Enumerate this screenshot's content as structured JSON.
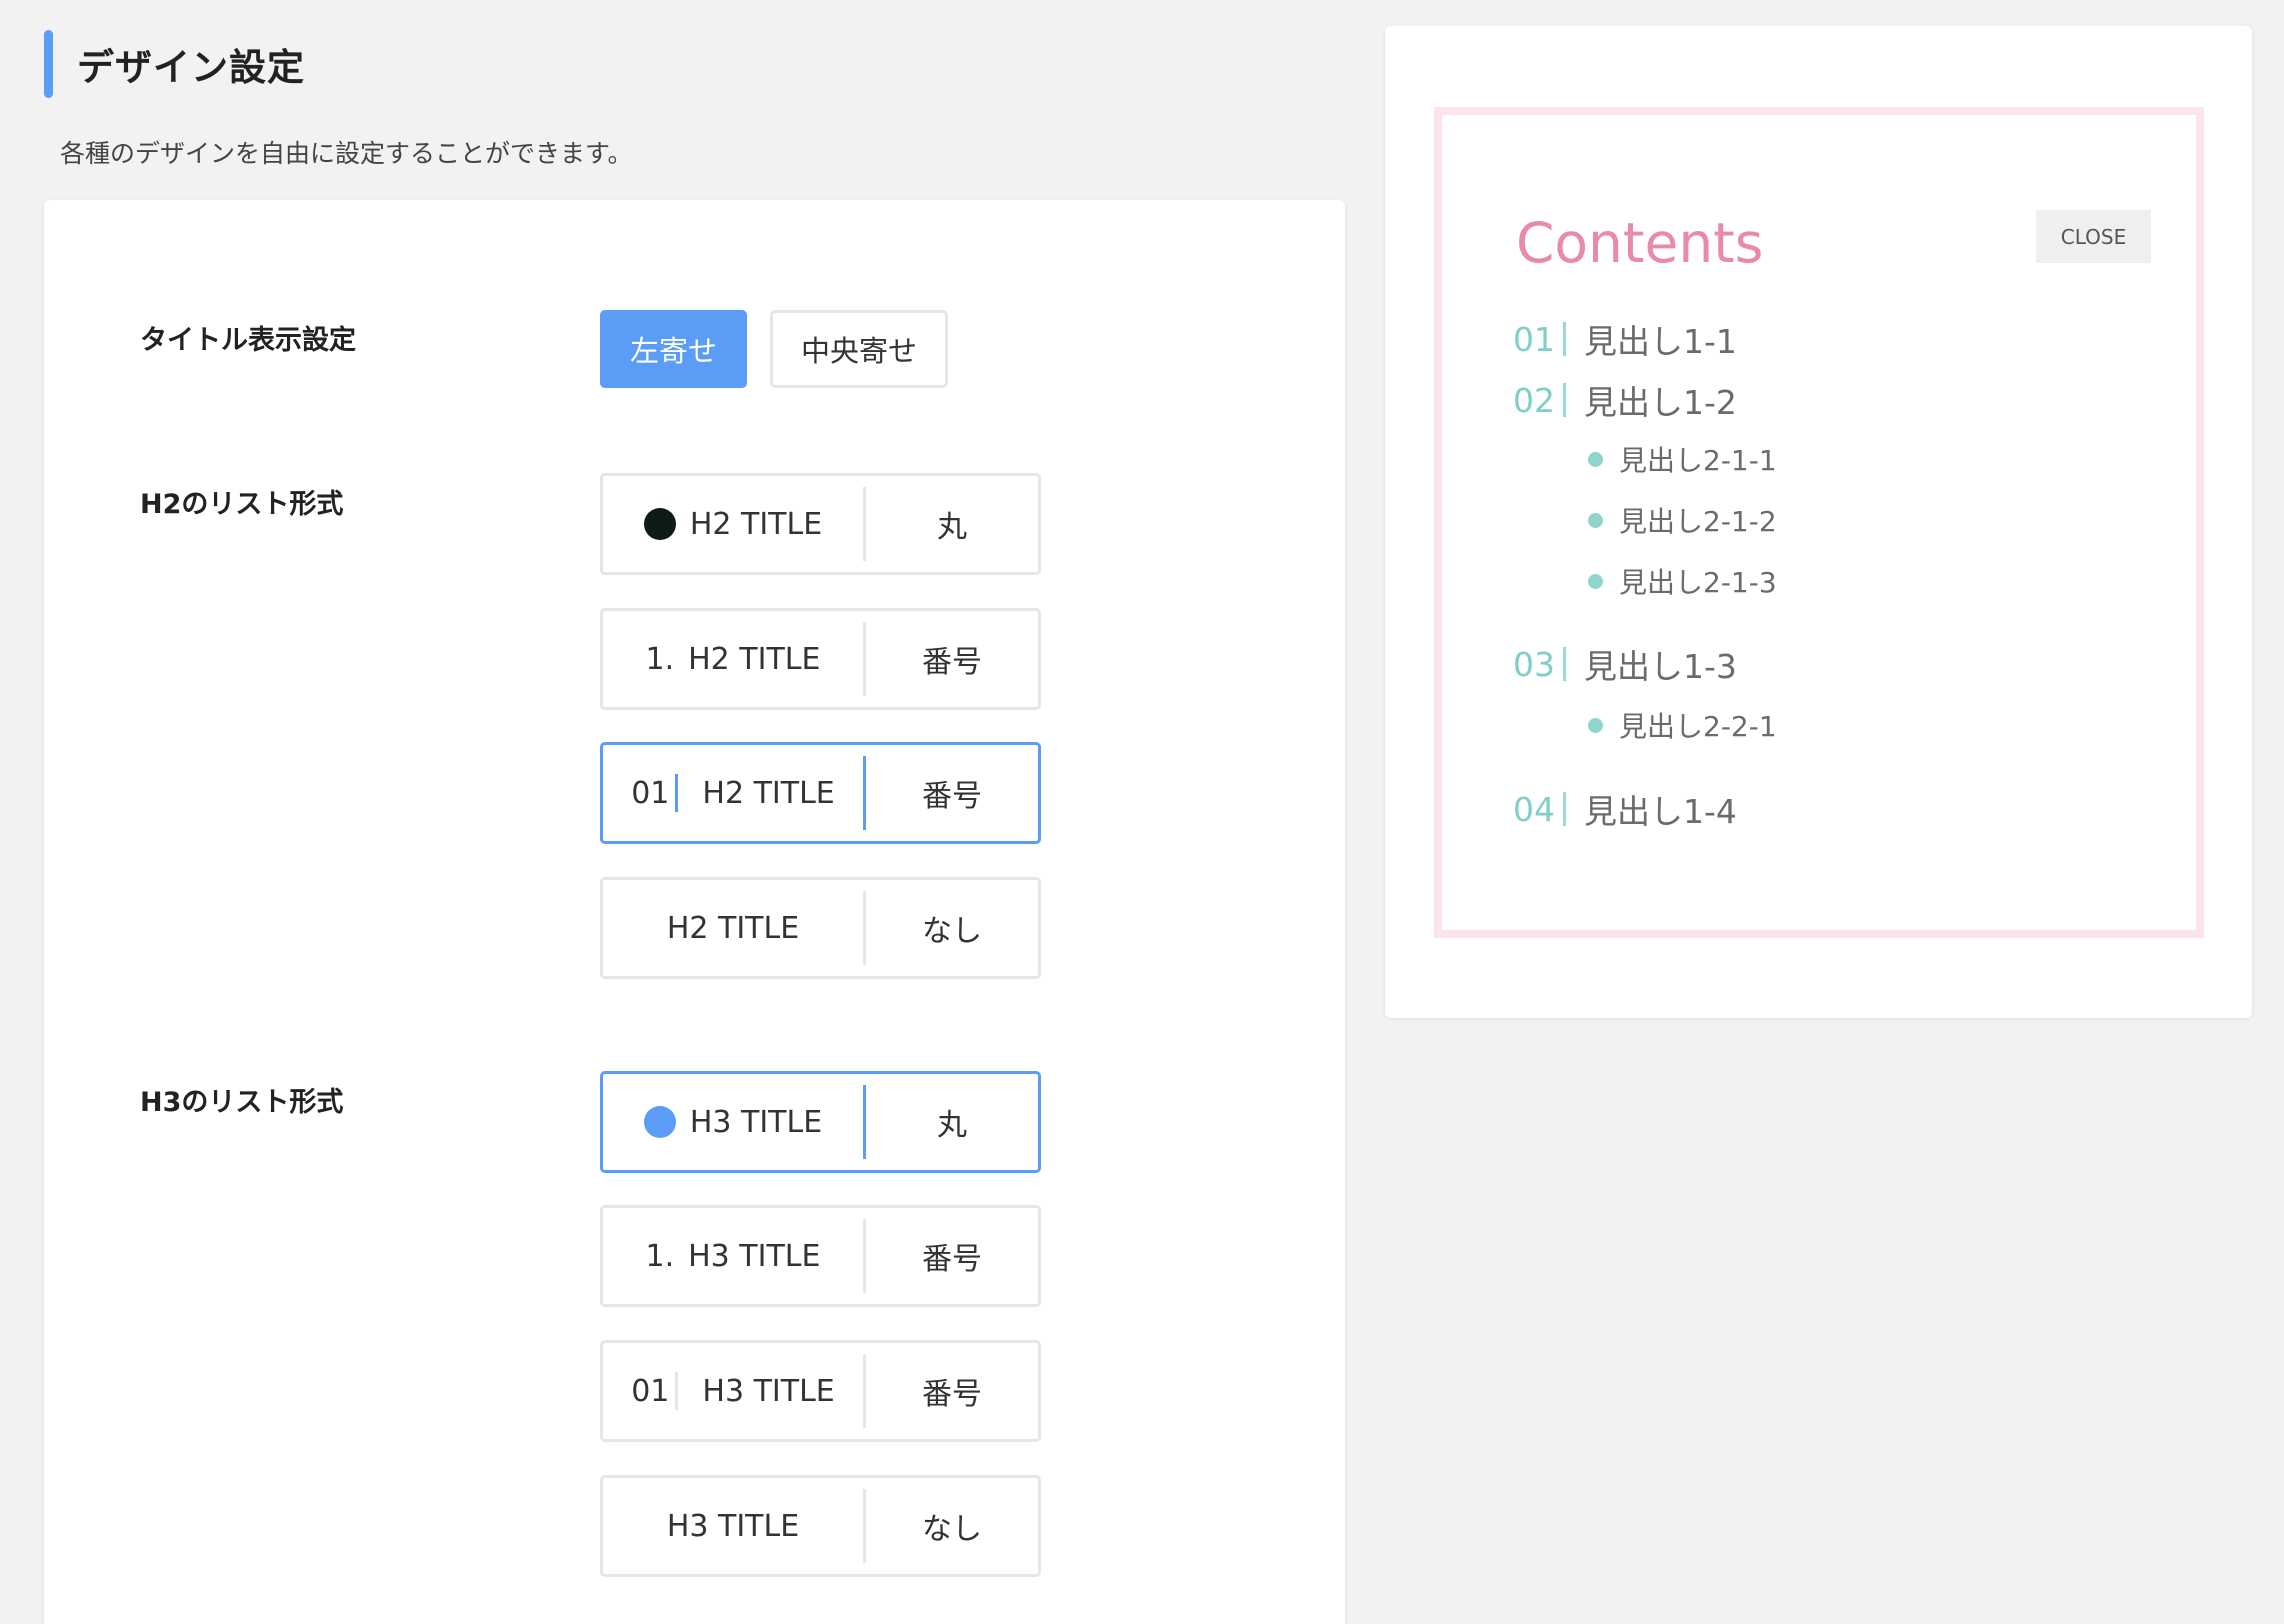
{
  "page": {
    "title": "デザイン設定",
    "description": "各種のデザインを自由に設定することができます。"
  },
  "title_display": {
    "label": "タイトル表示設定",
    "options": [
      "左寄せ",
      "中央寄せ"
    ],
    "selected": "左寄せ"
  },
  "h2_list": {
    "label": "H2のリスト形式",
    "options": [
      {
        "prefix": "",
        "title": "H2 TITLE",
        "name": "丸",
        "style": "dot"
      },
      {
        "prefix": "1.",
        "title": "H2 TITLE",
        "name": "番号",
        "style": "number-dot"
      },
      {
        "prefix": "01",
        "title": "H2 TITLE",
        "name": "番号",
        "style": "number-bar"
      },
      {
        "prefix": "",
        "title": "H2 TITLE",
        "name": "なし",
        "style": "none"
      }
    ],
    "selected_index": 2
  },
  "h3_list": {
    "label": "H3のリスト形式",
    "options": [
      {
        "prefix": "",
        "title": "H3 TITLE",
        "name": "丸",
        "style": "dot"
      },
      {
        "prefix": "1.",
        "title": "H3 TITLE",
        "name": "番号",
        "style": "number-dot"
      },
      {
        "prefix": "01",
        "title": "H3 TITLE",
        "name": "番号",
        "style": "number-bar"
      },
      {
        "prefix": "",
        "title": "H3 TITLE",
        "name": "なし",
        "style": "none"
      }
    ],
    "selected_index": 0
  },
  "preview": {
    "toc_title": "Contents",
    "close_label": "CLOSE",
    "items": [
      {
        "num": "01",
        "label": "見出し1-1",
        "children": []
      },
      {
        "num": "02",
        "label": "見出し1-2",
        "children": [
          "見出し2-1-1",
          "見出し2-1-2",
          "見出し2-1-3"
        ]
      },
      {
        "num": "03",
        "label": "見出し1-3",
        "children": [
          "見出し2-2-1"
        ]
      },
      {
        "num": "04",
        "label": "見出し1-4",
        "children": []
      }
    ]
  },
  "colors": {
    "accent": "#5b9cf6",
    "toc_title": "#e88aa8",
    "toc_border": "#fce4ea",
    "toc_number": "#7fcfc8",
    "dark_dot": "#0f1b16"
  }
}
